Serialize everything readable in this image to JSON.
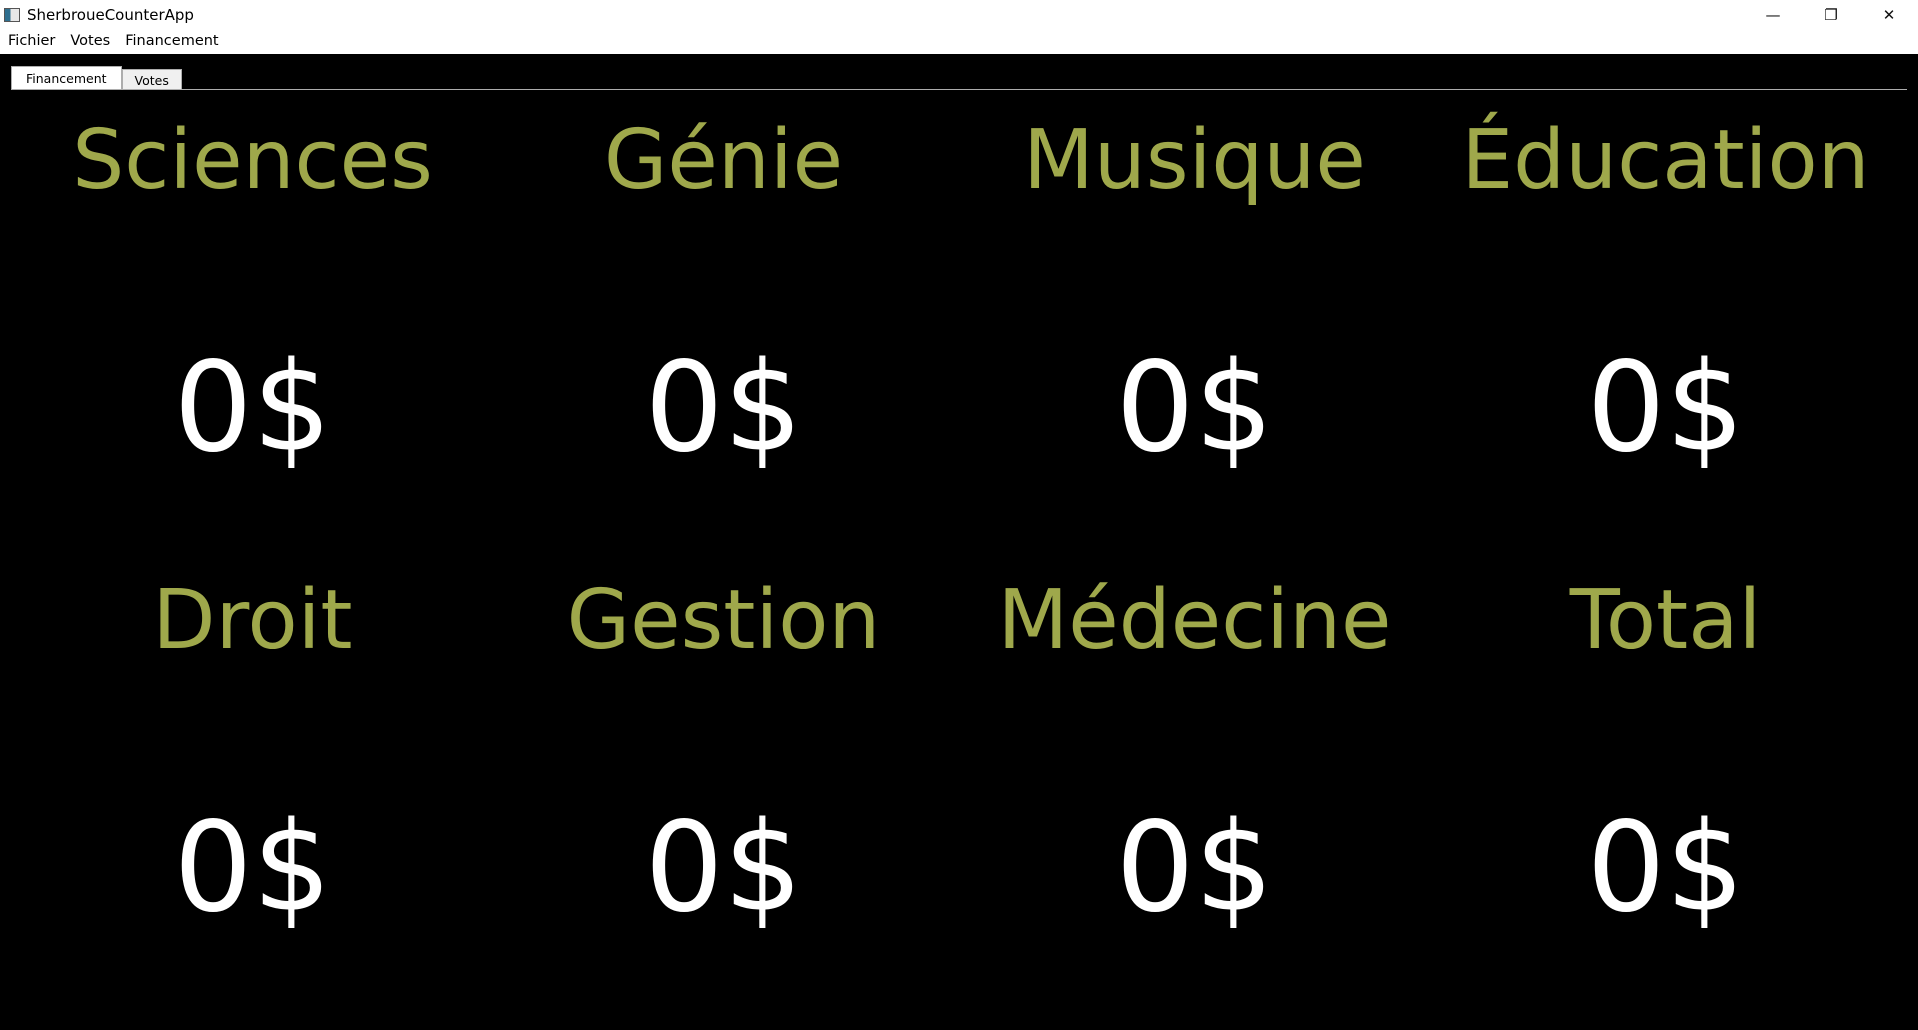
{
  "window": {
    "title": "SherbroueCounterApp",
    "controls": {
      "minimize": "—",
      "restore": "❐",
      "close": "✕"
    }
  },
  "menubar": {
    "items": [
      "Fichier",
      "Votes",
      "Financement"
    ]
  },
  "tabs": [
    {
      "label": "Financement",
      "active": true
    },
    {
      "label": "Votes",
      "active": false
    }
  ],
  "colors": {
    "background": "#000000",
    "faculty_name": "#9fa84b",
    "amount": "#ffffff"
  },
  "faculties": [
    {
      "name": "Sciences",
      "amount": "0$"
    },
    {
      "name": "Génie",
      "amount": "0$"
    },
    {
      "name": "Musique",
      "amount": "0$"
    },
    {
      "name": "Éducation",
      "amount": "0$"
    },
    {
      "name": "Droit",
      "amount": "0$"
    },
    {
      "name": "Gestion",
      "amount": "0$"
    },
    {
      "name": "Médecine",
      "amount": "0$"
    },
    {
      "name": "Total",
      "amount": "0$"
    }
  ]
}
